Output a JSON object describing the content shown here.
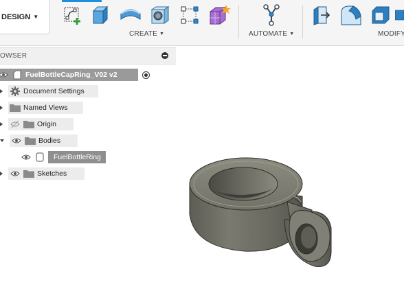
{
  "toolbar": {
    "workspace_label": "DESIGN",
    "groups": {
      "create": "CREATE",
      "automate": "AUTOMATE",
      "modify": "MODIFY"
    },
    "icons": [
      "create-sketch-icon",
      "extrude-icon",
      "revolve-icon",
      "hole-icon",
      "pattern-icon",
      "create-form-icon",
      "automate-icon",
      "press-pull-icon",
      "fillet-icon",
      "shell-icon"
    ],
    "accent": "#1d8fe0"
  },
  "browser": {
    "header": "OWSER",
    "root": {
      "label": "FuelBottleCapRing_V02 v2"
    },
    "items": [
      {
        "label": "Document Settings"
      },
      {
        "label": "Named Views"
      },
      {
        "label": "Origin"
      },
      {
        "label": "Bodies"
      },
      {
        "label": "FuelBottleRing"
      },
      {
        "label": "Sketches"
      }
    ]
  },
  "colors": {
    "selection": "#8f8f8f",
    "model_body": "#6b6b62",
    "folder": "#8a8a8a"
  }
}
